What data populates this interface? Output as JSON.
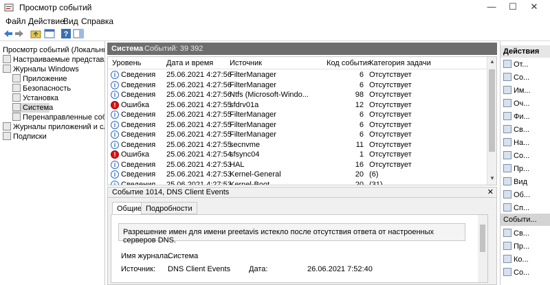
{
  "window": {
    "title": "Просмотр событий",
    "minimize": "—",
    "maximize": "☐",
    "close": "✕"
  },
  "menu": [
    "Файл",
    "Действие",
    "Вид",
    "Справка"
  ],
  "toolbar_icons": [
    "back-icon",
    "forward-icon",
    "folder-up-icon",
    "properties-icon",
    "help-icon",
    "panel-icon"
  ],
  "tree": {
    "root": "Просмотр событий (Локальный)",
    "items": [
      {
        "label": "Настраиваемые представления",
        "level": 1
      },
      {
        "label": "Журналы Windows",
        "level": 1
      },
      {
        "label": "Приложение",
        "level": 2
      },
      {
        "label": "Безопасность",
        "level": 2
      },
      {
        "label": "Установка",
        "level": 2
      },
      {
        "label": "Система",
        "level": 2,
        "selected": true
      },
      {
        "label": "Перенаправленные события",
        "level": 2
      },
      {
        "label": "Журналы приложений и служб",
        "level": 1
      },
      {
        "label": "Подписки",
        "level": 1
      }
    ]
  },
  "log": {
    "title": "Система",
    "count": "Событий: 39 392",
    "columns": [
      "Уровень",
      "Дата и время",
      "Источник",
      "Код события",
      "Категория задачи"
    ],
    "rows": [
      {
        "level": "Сведения",
        "type": "info",
        "date": "25.06.2021 4:27:56",
        "source": "FilterManager",
        "code": "6",
        "category": "Отсутствует"
      },
      {
        "level": "Сведения",
        "type": "info",
        "date": "25.06.2021 4:27:56",
        "source": "FilterManager",
        "code": "6",
        "category": "Отсутствует"
      },
      {
        "level": "Сведения",
        "type": "info",
        "date": "25.06.2021 4:27:56",
        "source": "Ntfs (Microsoft-Windo...",
        "code": "98",
        "category": "Отсутствует"
      },
      {
        "level": "Ошибка",
        "type": "err",
        "date": "25.06.2021 4:27:55",
        "source": "sfdrv01a",
        "code": "12",
        "category": "Отсутствует"
      },
      {
        "level": "Сведения",
        "type": "info",
        "date": "25.06.2021 4:27:55",
        "source": "FilterManager",
        "code": "6",
        "category": "Отсутствует"
      },
      {
        "level": "Сведения",
        "type": "info",
        "date": "25.06.2021 4:27:55",
        "source": "FilterManager",
        "code": "6",
        "category": "Отсутствует"
      },
      {
        "level": "Сведения",
        "type": "info",
        "date": "25.06.2021 4:27:55",
        "source": "FilterManager",
        "code": "6",
        "category": "Отсутствует"
      },
      {
        "level": "Сведения",
        "type": "info",
        "date": "25.06.2021 4:27:55",
        "source": "secnvme",
        "code": "11",
        "category": "Отсутствует"
      },
      {
        "level": "Ошибка",
        "type": "err",
        "date": "25.06.2021 4:27:54",
        "source": "sfsync04",
        "code": "1",
        "category": "Отсутствует"
      },
      {
        "level": "Сведения",
        "type": "info",
        "date": "25.06.2021 4:27:53",
        "source": "HAL",
        "code": "16",
        "category": "Отсутствует"
      },
      {
        "level": "Сведения",
        "type": "info",
        "date": "25.06.2021 4:27:53",
        "source": "Kernel-General",
        "code": "20",
        "category": "(6)"
      },
      {
        "level": "Сведения",
        "type": "info",
        "date": "25.06.2021 4:27:53",
        "source": "Kernel-Boot",
        "code": "20",
        "category": "(31)"
      }
    ]
  },
  "detail": {
    "title": "Событие 1014, DNS Client Events",
    "close": "✕",
    "tabs": [
      "Общие",
      "Подробности"
    ],
    "message": "Разрешение имен для имени preetavis истекло после отсутствия ответа от настроенных серверов DNS.",
    "log_name_label": "Имя журнала:",
    "log_name_value": "Система",
    "source_label": "Источник:",
    "source_value": "DNS Client Events",
    "date_label": "Дата:",
    "date_value": "26.06.2021 7:52:40"
  },
  "actions": {
    "header": "Действия",
    "items": [
      "От...",
      "Со...",
      "Им...",
      "Оч...",
      "Фи...",
      "Св...",
      "На...",
      "Со...",
      "Пр...",
      "Вид",
      "Об...",
      "Сп..."
    ],
    "section2": "Событи...",
    "items2": [
      "Св...",
      "Пр...",
      "Ко...",
      "Со..."
    ]
  }
}
